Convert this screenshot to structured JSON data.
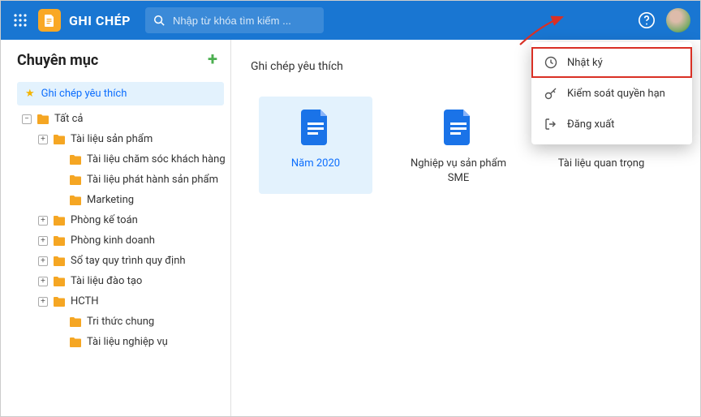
{
  "header": {
    "app_title": "GHI CHÉP",
    "search_placeholder": "Nhập từ khóa tìm kiếm ..."
  },
  "sidebar": {
    "title": "Chuyên mục",
    "favorite_label": "Ghi chép yêu thích",
    "tree": [
      {
        "label": "Tất cả",
        "expanded": true,
        "indent": 1
      },
      {
        "label": "Tài liệu sản phẩm",
        "expanded": true,
        "indent": 2,
        "toggle": "+"
      },
      {
        "label": "Tài liệu chăm sóc khách hàng",
        "indent": 3
      },
      {
        "label": "Tài liệu phát hành sản phẩm",
        "indent": 3
      },
      {
        "label": "Marketing",
        "indent": 3
      },
      {
        "label": "Phòng kế toán",
        "indent": 2,
        "toggle": "+"
      },
      {
        "label": "Phòng kinh doanh",
        "indent": 2,
        "toggle": "+"
      },
      {
        "label": "Sổ tay quy trình quy định",
        "indent": 2,
        "toggle": "+"
      },
      {
        "label": "Tài liệu đào tạo",
        "indent": 2,
        "toggle": "+"
      },
      {
        "label": "HCTH",
        "indent": 2,
        "toggle": "+"
      },
      {
        "label": "Tri thức chung",
        "indent": 3
      },
      {
        "label": "Tài liệu nghiệp vụ",
        "indent": 3
      }
    ]
  },
  "main": {
    "title": "Ghi chép yêu thích",
    "items": [
      {
        "label": "Năm 2020",
        "type": "doc",
        "selected": true
      },
      {
        "label": "Nghiệp vụ sản phẩm SME",
        "type": "doc"
      },
      {
        "label": "Tài liệu quan trọng",
        "type": "folder"
      }
    ]
  },
  "menu": {
    "items": [
      {
        "icon": "history-icon",
        "label": "Nhật ký",
        "highlight": true
      },
      {
        "icon": "key-icon",
        "label": "Kiểm soát quyền hạn"
      },
      {
        "icon": "logout-icon",
        "label": "Đăng xuất"
      }
    ]
  }
}
